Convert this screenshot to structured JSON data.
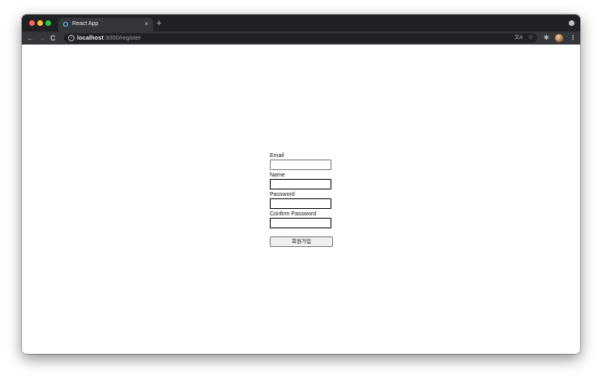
{
  "browser": {
    "tab": {
      "title": "React App",
      "close_glyph": "×",
      "favicon": "react-icon"
    },
    "new_tab_glyph": "+",
    "nav": {
      "back_glyph": "←",
      "forward_glyph": "→",
      "reload_glyph": "C"
    },
    "address": {
      "host": "localhost",
      "path": ":3000/register"
    },
    "icons": {
      "info_glyph": "i",
      "translate_glyph": "文A",
      "bookmark_glyph": "☆",
      "extensions_glyph": "✱",
      "menu_glyph": "⋮"
    }
  },
  "form": {
    "email": {
      "label": "Email",
      "value": ""
    },
    "name": {
      "label": "Name",
      "value": ""
    },
    "password": {
      "label": "Password",
      "value": ""
    },
    "confirm_password": {
      "label": "Confirm Password",
      "value": ""
    },
    "submit_label": "회원가입"
  },
  "colors": {
    "tabstrip": "#202124",
    "toolbar": "#35363a",
    "page_background": "#ffffff"
  }
}
